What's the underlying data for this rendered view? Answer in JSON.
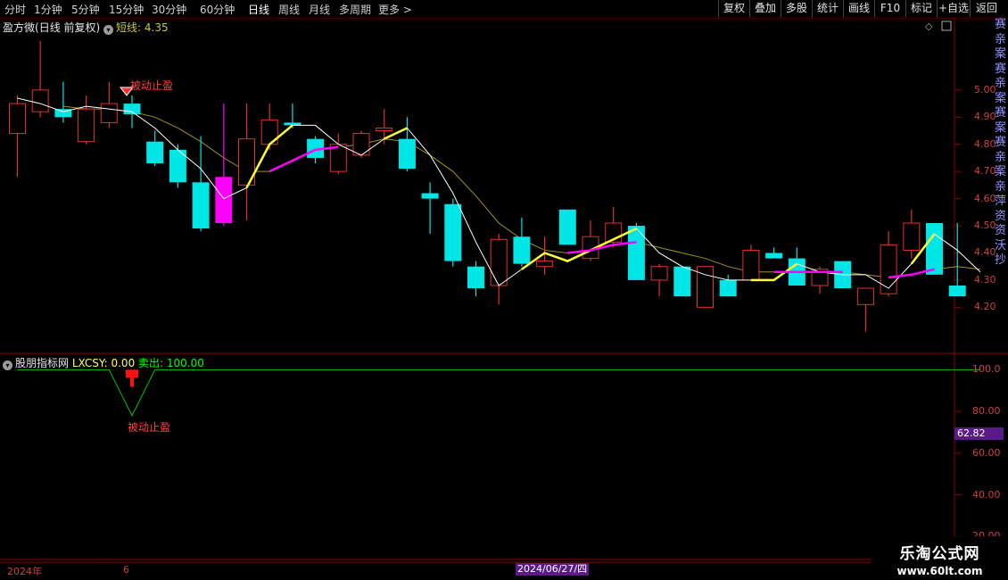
{
  "toolbar": {
    "timeframes": [
      "分时",
      "1分钟",
      "5分钟",
      "15分钟",
      "30分钟",
      "60分钟",
      "日线",
      "周线",
      "月线",
      "多周期",
      "更多"
    ],
    "active": "日线",
    "buttons": [
      "复权",
      "叠加",
      "多股",
      "统计",
      "画线",
      "F10",
      "标记",
      "+自选",
      "返回"
    ]
  },
  "main_chart": {
    "stock_name": "盈方微",
    "period_info": "(日线 前复权)",
    "short_label": "短线:",
    "short_value": "4.35",
    "signal_text": "被动止盈"
  },
  "lower_chart": {
    "title": "股朋指标网",
    "lxcsy_label": "LXCSY:",
    "lxcsy_value": "0.00",
    "sell_label": "卖出:",
    "sell_value": "100.00",
    "signal_text": "被动止盈",
    "badge_value": "62.82"
  },
  "date_axis": {
    "year": "2024年",
    "month": "6",
    "cursor_date": "2024/06/27/四"
  },
  "watermark": {
    "line1": "乐淘公式网",
    "line2": "www.60lt.com"
  },
  "right_strip_text": "赛亲案赛亲案赛案赛亲案亲萍资资沃抄",
  "colors": {
    "up": "#e03030",
    "down": "#00e5e5",
    "magenta": "#ff00ff",
    "yellow": "#ffff30",
    "white": "#ffffff",
    "ma_olive": "#a09020",
    "green": "#00c000",
    "background": "#000000"
  },
  "chart_data": [
    {
      "type": "candlestick",
      "ylim": [
        4.05,
        5.2
      ],
      "y_ticks": [
        "5.00",
        "4.90",
        "4.80",
        "4.70",
        "4.60",
        "4.50",
        "4.40",
        "4.30",
        "4.20"
      ],
      "candles": [
        {
          "o": 4.84,
          "h": 4.98,
          "l": 4.68,
          "c": 4.95
        },
        {
          "o": 4.92,
          "h": 5.18,
          "l": 4.9,
          "c": 5.0
        },
        {
          "o": 4.93,
          "h": 5.03,
          "l": 4.88,
          "c": 4.9
        },
        {
          "o": 4.81,
          "h": 4.98,
          "l": 4.8,
          "c": 4.93
        },
        {
          "o": 4.88,
          "h": 5.03,
          "l": 4.86,
          "c": 4.95
        },
        {
          "o": 4.95,
          "h": 4.98,
          "l": 4.86,
          "c": 4.91
        },
        {
          "o": 4.81,
          "h": 4.85,
          "l": 4.72,
          "c": 4.73
        },
        {
          "o": 4.78,
          "h": 4.8,
          "l": 4.64,
          "c": 4.66
        },
        {
          "o": 4.66,
          "h": 4.83,
          "l": 4.48,
          "c": 4.49
        },
        {
          "o": 4.51,
          "h": 4.95,
          "l": 4.5,
          "c": 4.68,
          "color": "magenta"
        },
        {
          "o": 4.65,
          "h": 4.95,
          "l": 4.52,
          "c": 4.82
        },
        {
          "o": 4.8,
          "h": 4.95,
          "l": 4.78,
          "c": 4.89
        },
        {
          "o": 4.88,
          "h": 4.95,
          "l": 4.86,
          "c": 4.87
        },
        {
          "o": 4.82,
          "h": 4.83,
          "l": 4.73,
          "c": 4.75
        },
        {
          "o": 4.7,
          "h": 4.84,
          "l": 4.69,
          "c": 4.8
        },
        {
          "o": 4.76,
          "h": 4.85,
          "l": 4.75,
          "c": 4.84
        },
        {
          "o": 4.85,
          "h": 4.93,
          "l": 4.8,
          "c": 4.86
        },
        {
          "o": 4.82,
          "h": 4.9,
          "l": 4.7,
          "c": 4.71
        },
        {
          "o": 4.62,
          "h": 4.66,
          "l": 4.47,
          "c": 4.6
        },
        {
          "o": 4.58,
          "h": 4.6,
          "l": 4.35,
          "c": 4.37
        },
        {
          "o": 4.35,
          "h": 4.37,
          "l": 4.24,
          "c": 4.27
        },
        {
          "o": 4.28,
          "h": 4.47,
          "l": 4.21,
          "c": 4.45
        },
        {
          "o": 4.46,
          "h": 4.53,
          "l": 4.35,
          "c": 4.36
        },
        {
          "o": 4.35,
          "h": 4.46,
          "l": 4.32,
          "c": 4.37
        },
        {
          "o": 4.56,
          "h": 4.56,
          "l": 4.43,
          "c": 4.43
        },
        {
          "o": 4.38,
          "h": 4.52,
          "l": 4.37,
          "c": 4.46
        },
        {
          "o": 4.44,
          "h": 4.57,
          "l": 4.42,
          "c": 4.51
        },
        {
          "o": 4.5,
          "h": 4.51,
          "l": 4.3,
          "c": 4.3
        },
        {
          "o": 4.3,
          "h": 4.36,
          "l": 4.24,
          "c": 4.35
        },
        {
          "o": 4.35,
          "h": 4.35,
          "l": 4.24,
          "c": 4.24
        },
        {
          "o": 4.2,
          "h": 4.35,
          "l": 4.2,
          "c": 4.35
        },
        {
          "o": 4.3,
          "h": 4.32,
          "l": 4.24,
          "c": 4.24
        },
        {
          "o": 4.3,
          "h": 4.43,
          "l": 4.3,
          "c": 4.41
        },
        {
          "o": 4.4,
          "h": 4.42,
          "l": 4.38,
          "c": 4.38
        },
        {
          "o": 4.38,
          "h": 4.42,
          "l": 4.28,
          "c": 4.28
        },
        {
          "o": 4.28,
          "h": 4.35,
          "l": 4.25,
          "c": 4.34
        },
        {
          "o": 4.37,
          "h": 4.37,
          "l": 4.27,
          "c": 4.27
        },
        {
          "o": 4.21,
          "h": 4.27,
          "l": 4.11,
          "c": 4.27
        },
        {
          "o": 4.25,
          "h": 4.48,
          "l": 4.24,
          "c": 4.43
        },
        {
          "o": 4.41,
          "h": 4.56,
          "l": 4.38,
          "c": 4.51
        },
        {
          "o": 4.51,
          "h": 4.51,
          "l": 4.32,
          "c": 4.32
        },
        {
          "o": 4.28,
          "h": 4.51,
          "l": 4.24,
          "c": 4.24
        }
      ],
      "line_white": [
        4.97,
        4.95,
        4.92,
        4.94,
        4.93,
        4.92,
        4.86,
        4.78,
        4.71,
        4.6,
        4.64,
        4.8,
        4.87,
        4.87,
        4.8,
        4.76,
        4.82,
        4.86,
        4.76,
        4.62,
        4.44,
        4.28,
        4.34,
        4.4,
        4.37,
        4.41,
        4.45,
        4.49,
        4.4,
        4.35,
        4.32,
        4.3,
        4.3,
        4.3,
        4.36,
        4.33,
        4.32,
        4.32,
        4.27,
        4.36,
        4.47,
        4.41,
        4.33
      ],
      "line_ma": [
        null,
        null,
        4.94,
        4.93,
        4.93,
        4.92,
        4.9,
        4.86,
        4.81,
        4.75,
        4.7,
        4.7,
        4.74,
        4.78,
        4.79,
        4.8,
        4.82,
        4.81,
        4.76,
        4.7,
        4.61,
        4.51,
        4.45,
        4.41,
        4.4,
        4.41,
        4.43,
        4.44,
        4.42,
        4.4,
        4.38,
        4.35,
        4.33,
        4.33,
        4.33,
        4.33,
        4.33,
        4.32,
        4.31,
        4.32,
        4.34,
        4.35,
        4.34
      ],
      "trend_segments": [
        {
          "color": "yellow",
          "from": 10,
          "to": 12
        },
        {
          "color": "magenta",
          "from": 11,
          "to": 14
        },
        {
          "color": "yellow",
          "from": 16,
          "to": 17
        },
        {
          "color": "yellow",
          "from": 22,
          "to": 27
        },
        {
          "color": "magenta",
          "from": 24,
          "to": 27
        },
        {
          "color": "yellow",
          "from": 32,
          "to": 34
        },
        {
          "color": "magenta",
          "from": 33,
          "to": 36
        },
        {
          "color": "yellow",
          "from": 39,
          "to": 40
        },
        {
          "color": "magenta",
          "from": 38,
          "to": 40
        }
      ],
      "signal_index": 5
    },
    {
      "type": "line",
      "ylim": [
        12,
        104
      ],
      "y_ticks": [
        "100.0",
        "80.00",
        "60.00",
        "40.00",
        "20.00"
      ],
      "series": [
        {
          "values": [
            100,
            100,
            100,
            100,
            100,
            78,
            100,
            100,
            100,
            100,
            100,
            100,
            100,
            100,
            100,
            100,
            100,
            100,
            100,
            100,
            100,
            100,
            100,
            100,
            100,
            100,
            100,
            100,
            100,
            100,
            100,
            100,
            100,
            100,
            100,
            100,
            100,
            100,
            100,
            100,
            100,
            100,
            100
          ]
        }
      ],
      "signal_index": 5
    }
  ]
}
